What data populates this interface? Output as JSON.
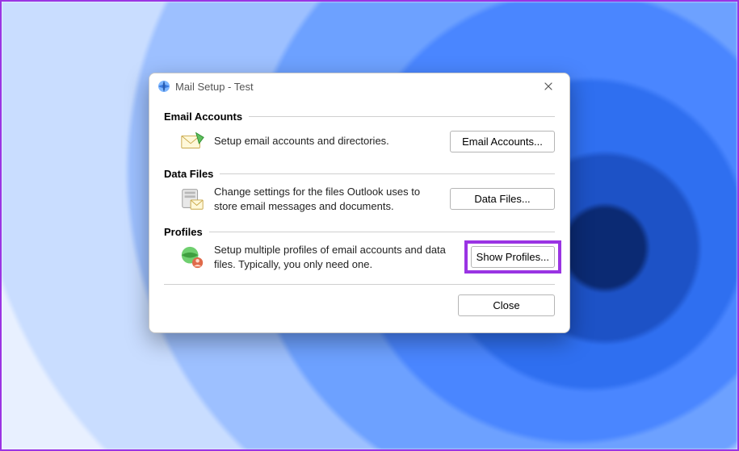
{
  "window": {
    "title": "Mail Setup - Test"
  },
  "sections": {
    "email_accounts": {
      "header": "Email Accounts",
      "description": "Setup email accounts and directories.",
      "button": "Email Accounts..."
    },
    "data_files": {
      "header": "Data Files",
      "description": "Change settings for the files Outlook uses to store email messages and documents.",
      "button": "Data Files..."
    },
    "profiles": {
      "header": "Profiles",
      "description": "Setup multiple profiles of email accounts and data files. Typically, you only need one.",
      "button": "Show Profiles..."
    }
  },
  "footer": {
    "close": "Close"
  }
}
